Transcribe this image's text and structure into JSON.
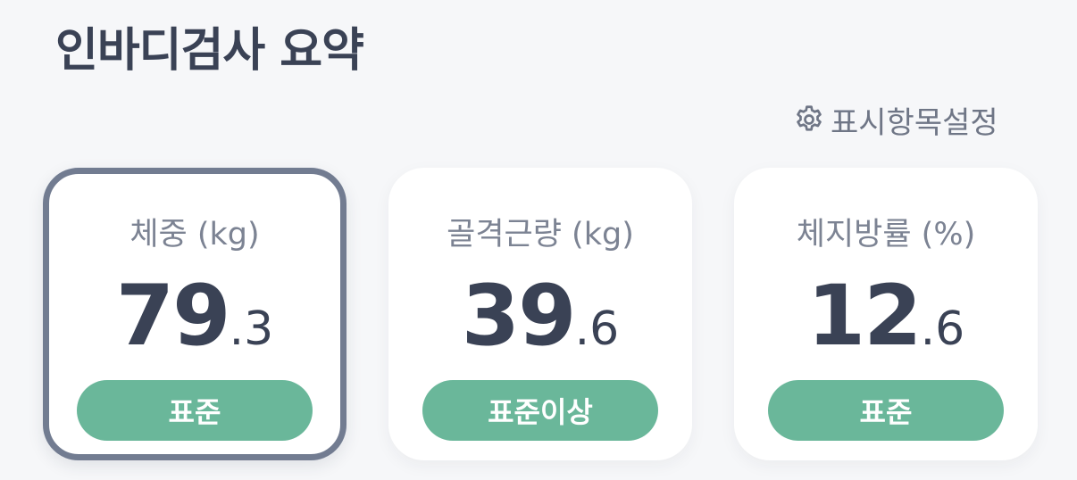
{
  "page": {
    "title": "인바디검사 요약"
  },
  "settings": {
    "label": "표시항목설정",
    "icon": "gear-icon"
  },
  "cards": [
    {
      "label": "체중 (kg)",
      "value_int": "79",
      "value_dec": ".3",
      "status": "표준",
      "selected": true
    },
    {
      "label": "골격근량 (kg)",
      "value_int": "39",
      "value_dec": ".6",
      "status": "표준이상",
      "selected": false
    },
    {
      "label": "체지방률 (%)",
      "value_int": "12",
      "value_dec": ".6",
      "status": "표준",
      "selected": false
    }
  ],
  "colors": {
    "background": "#f6f7f9",
    "text_primary": "#3a4255",
    "text_secondary": "#7c8393",
    "status_green": "#6ab79a",
    "selected_border": "#727c91"
  }
}
